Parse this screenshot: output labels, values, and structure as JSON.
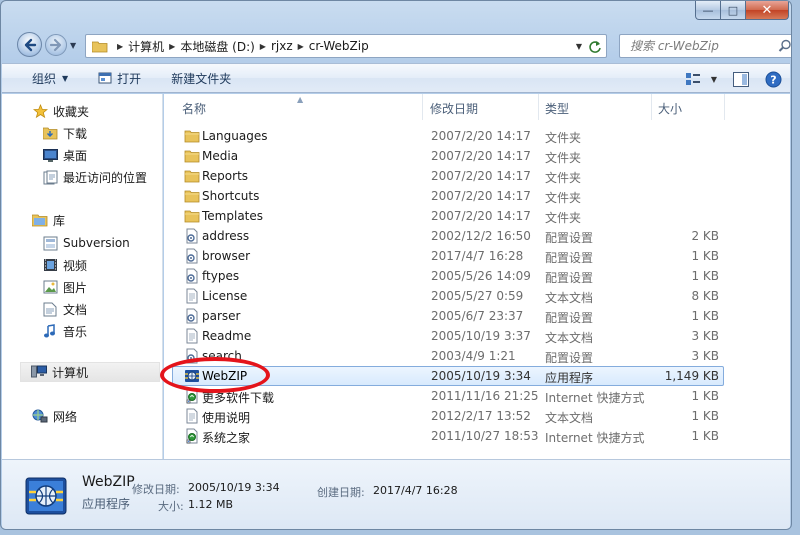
{
  "window": {
    "caption": {
      "minimize": "—",
      "maximize": "□",
      "close": "✕"
    }
  },
  "address": {
    "crumbs": [
      "计算机",
      "本地磁盘 (D:)",
      "rjxz",
      "cr-WebZip"
    ],
    "search_placeholder": "搜索 cr-WebZip"
  },
  "toolbar": {
    "organize": "组织",
    "open": "打开",
    "new_folder": "新建文件夹"
  },
  "nav": {
    "favorites": "收藏夹",
    "downloads": "下载",
    "desktop": "桌面",
    "recent": "最近访问的位置",
    "libraries": "库",
    "subversion": "Subversion",
    "videos": "视频",
    "pictures": "图片",
    "documents": "文档",
    "music": "音乐",
    "computer": "计算机",
    "network": "网络"
  },
  "columns": {
    "name": "名称",
    "modified": "修改日期",
    "type": "类型",
    "size": "大小"
  },
  "files": [
    {
      "name": "Languages",
      "modified": "2007/2/20 14:17",
      "type": "文件夹",
      "size": "",
      "icon": "folder-icon"
    },
    {
      "name": "Media",
      "modified": "2007/2/20 14:17",
      "type": "文件夹",
      "size": "",
      "icon": "folder-icon"
    },
    {
      "name": "Reports",
      "modified": "2007/2/20 14:17",
      "type": "文件夹",
      "size": "",
      "icon": "folder-icon"
    },
    {
      "name": "Shortcuts",
      "modified": "2007/2/20 14:17",
      "type": "文件夹",
      "size": "",
      "icon": "folder-icon"
    },
    {
      "name": "Templates",
      "modified": "2007/2/20 14:17",
      "type": "文件夹",
      "size": "",
      "icon": "folder-icon"
    },
    {
      "name": "address",
      "modified": "2002/12/2 16:50",
      "type": "配置设置",
      "size": "2 KB",
      "icon": "config-file-icon"
    },
    {
      "name": "browser",
      "modified": "2017/4/7 16:28",
      "type": "配置设置",
      "size": "1 KB",
      "icon": "config-file-icon"
    },
    {
      "name": "ftypes",
      "modified": "2005/5/26 14:09",
      "type": "配置设置",
      "size": "1 KB",
      "icon": "config-file-icon"
    },
    {
      "name": "License",
      "modified": "2005/5/27 0:59",
      "type": "文本文档",
      "size": "8 KB",
      "icon": "text-file-icon"
    },
    {
      "name": "parser",
      "modified": "2005/6/7 23:37",
      "type": "配置设置",
      "size": "1 KB",
      "icon": "config-file-icon"
    },
    {
      "name": "Readme",
      "modified": "2005/10/19 3:37",
      "type": "文本文档",
      "size": "3 KB",
      "icon": "text-file-icon"
    },
    {
      "name": "search",
      "modified": "2003/4/9 1:21",
      "type": "配置设置",
      "size": "3 KB",
      "icon": "config-file-icon"
    },
    {
      "name": "WebZIP",
      "modified": "2005/10/19 3:34",
      "type": "应用程序",
      "size": "1,149 KB",
      "icon": "webzip-app-icon"
    },
    {
      "name": "更多软件下载",
      "modified": "2011/11/16 21:25",
      "type": "Internet 快捷方式",
      "size": "1 KB",
      "icon": "internet-shortcut-icon"
    },
    {
      "name": "使用说明",
      "modified": "2012/2/17 13:52",
      "type": "文本文档",
      "size": "1 KB",
      "icon": "text-file-icon"
    },
    {
      "name": "系统之家",
      "modified": "2011/10/27 18:53",
      "type": "Internet 快捷方式",
      "size": "1 KB",
      "icon": "internet-shortcut-icon"
    }
  ],
  "selected_index": 12,
  "details": {
    "name": "WebZIP",
    "type": "应用程序",
    "modified_label": "修改日期:",
    "modified_value": "2005/10/19 3:34",
    "created_label": "创建日期:",
    "created_value": "2017/4/7 16:28",
    "size_label": "大小:",
    "size_value": "1.12 MB"
  },
  "colors": {
    "selection_border": "#84acdd",
    "highlight_ring": "#e4141b",
    "folder": "#e8c35b"
  }
}
